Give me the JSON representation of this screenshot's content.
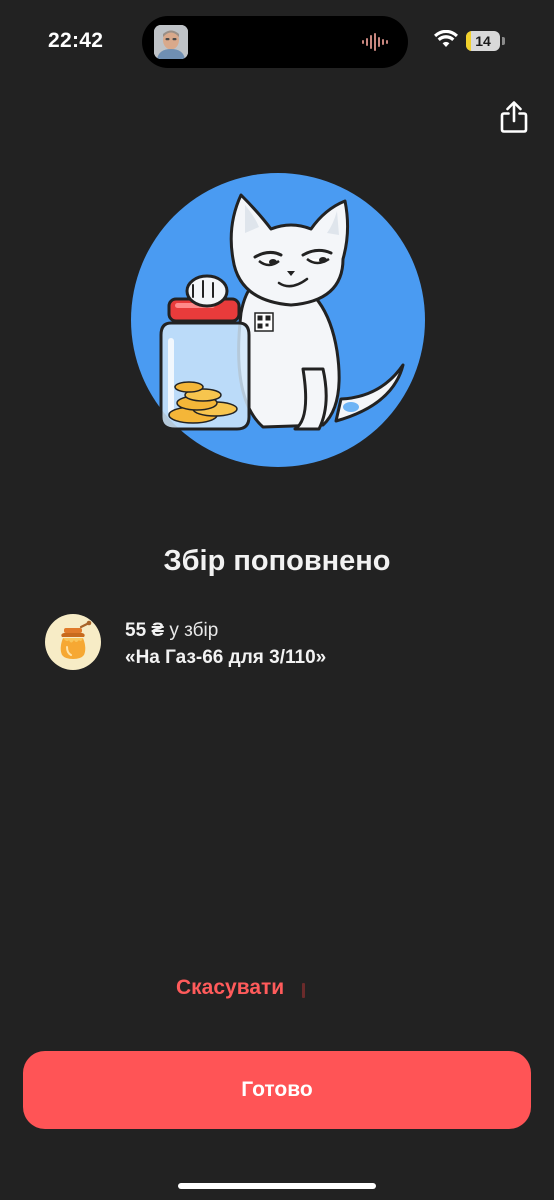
{
  "status_bar": {
    "time": "22:42",
    "battery_level": "14",
    "battery_fraction": 0.14,
    "icons": [
      "wifi-icon",
      "battery-icon",
      "audio-wave-icon"
    ]
  },
  "header": {
    "share_icon": "share-icon"
  },
  "hero": {
    "illustration": "cat-with-coin-jar"
  },
  "title": "Збір поповнено",
  "transaction": {
    "icon": "honey-jar-icon",
    "amount": "55 ₴",
    "amount_suffix": " у збір",
    "jar_name": "«На Газ-66 для 3/110»"
  },
  "actions": {
    "cancel_label": "Скасувати",
    "done_label": "Готово"
  },
  "colors": {
    "background": "#222222",
    "accent": "#ff5456",
    "cancel_text": "#ff5b5b",
    "hero_circle": "#4a9bf2"
  }
}
